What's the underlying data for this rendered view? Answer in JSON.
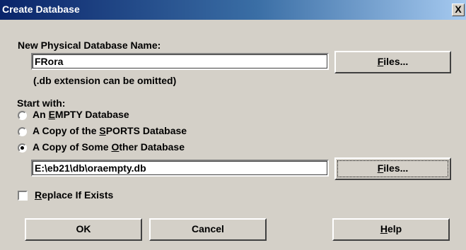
{
  "window": {
    "title": "Create Database",
    "close_glyph": "X"
  },
  "name_section": {
    "label_pre": "New Physical Database Name:",
    "value": "FRora",
    "files_button_key": "F",
    "files_button_rest": "iles...",
    "hint": "(.db extension can be omitted)"
  },
  "start_with": {
    "label": "Start with:",
    "options": [
      {
        "pre": "An ",
        "key": "E",
        "post": "MPTY Database",
        "selected": false
      },
      {
        "pre": "A Copy of the ",
        "key": "S",
        "post": "PORTS Database",
        "selected": false
      },
      {
        "pre": "A Copy of Some ",
        "key": "O",
        "post": "ther Database",
        "selected": true
      }
    ],
    "path_value": "E:\\eb21\\db\\oraempty.db",
    "files_button_key": "F",
    "files_button_rest": "iles..."
  },
  "replace": {
    "key": "R",
    "rest": "eplace If Exists",
    "checked": false
  },
  "buttons": {
    "ok": "OK",
    "cancel": "Cancel",
    "help_key": "H",
    "help_rest": "elp"
  },
  "icons": {
    "close": "close-icon"
  }
}
